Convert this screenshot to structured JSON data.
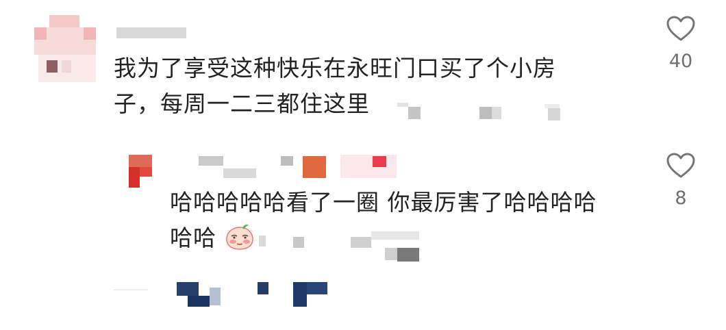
{
  "comments": [
    {
      "text_line1": "我为了享受这种快乐在永旺门口买了个小房",
      "text_line2": "子，每周一二三都住这里",
      "likes": "40"
    }
  ],
  "reply": {
    "text_line1": "哈哈哈哈哈看了一圈 你最厉害了哈哈哈哈",
    "text_line2": "哈哈",
    "likes": "8"
  },
  "icons": {
    "like": "heart-outline-icon",
    "emoji": "blushing-peach-emoji-icon"
  }
}
